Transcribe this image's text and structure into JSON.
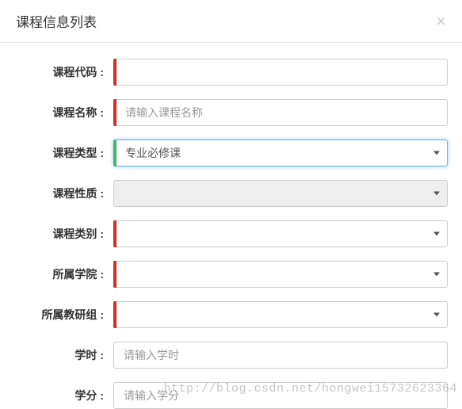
{
  "modal": {
    "title": "课程信息列表",
    "close": "×"
  },
  "form": {
    "code": {
      "label": "课程代码 :",
      "value": ""
    },
    "name": {
      "label": "课程名称 :",
      "placeholder": "请输入课程名称",
      "value": ""
    },
    "type": {
      "label": "课程类型 :",
      "selected": "专业必修课"
    },
    "nature": {
      "label": "课程性质 :",
      "selected": ""
    },
    "category": {
      "label": "课程类别 :",
      "selected": ""
    },
    "college": {
      "label": "所属学院 :",
      "selected": ""
    },
    "group": {
      "label": "所属教研组 :",
      "selected": ""
    },
    "hours": {
      "label": "学时 :",
      "placeholder": "请输入学时",
      "value": ""
    },
    "credits": {
      "label": "学分 :",
      "placeholder": "请输入学分",
      "value": ""
    }
  },
  "watermark": "http://blog.csdn.net/hongwei15732623364"
}
